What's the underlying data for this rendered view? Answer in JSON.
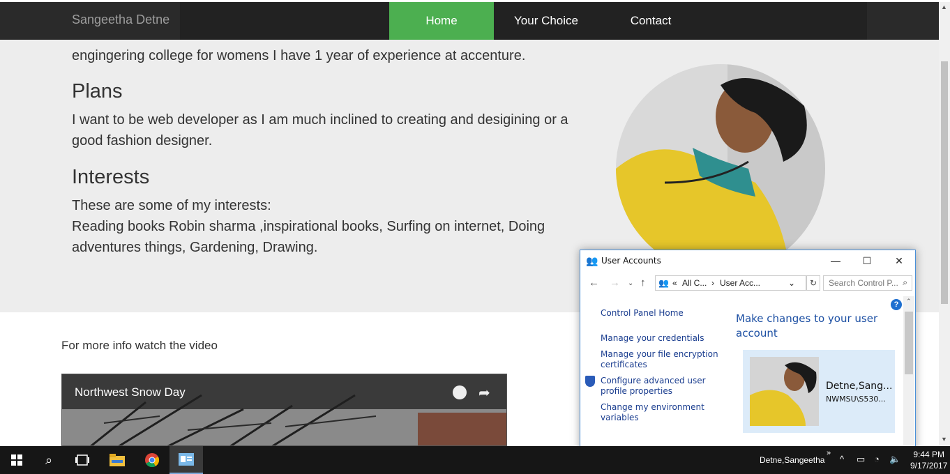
{
  "navbar": {
    "brand": "Sangeetha Detne",
    "items": [
      {
        "label": "Home",
        "active": true
      },
      {
        "label": "Your Choice",
        "active": false
      },
      {
        "label": "Contact",
        "active": false
      }
    ],
    "active_color": "#4caf50"
  },
  "about": {
    "line_partial": "engingering college for womens I have 1 year of experience at accenture.",
    "plans_heading": "Plans",
    "plans_text_1": "I want to be web developer as I am much inclined to creating and desigining or a",
    "plans_text_2": "good fashion designer.",
    "interests_heading": "Interests",
    "interests_intro": "These are some of my interests:",
    "interests_text_1": "Reading books Robin sharma ,inspirational books, Surfing on internet, Doing",
    "interests_text_2": "adventures things, Gardening, Drawing."
  },
  "video_section": {
    "info_text": "For more info watch the video",
    "video_title": "Northwest Snow Day",
    "clock_icon": "clock-icon",
    "share_icon": "share-icon"
  },
  "user_accounts_window": {
    "title": "User Accounts",
    "breadcrumb": [
      "All C...",
      "User Acc..."
    ],
    "search_placeholder": "Search Control P...",
    "sidebar_links": [
      "Control Panel Home",
      "Manage your credentials",
      "Manage your file encryption certificates",
      "Configure advanced user profile properties",
      "Change my environment variables"
    ],
    "heading": "Make changes to your user account",
    "user_name": "Detne,Sang...",
    "user_domain": "NWMSU\\S530..."
  },
  "taskbar": {
    "user": "Detne,Sangeetha",
    "time": "9:44 PM",
    "date": "9/17/2017"
  }
}
